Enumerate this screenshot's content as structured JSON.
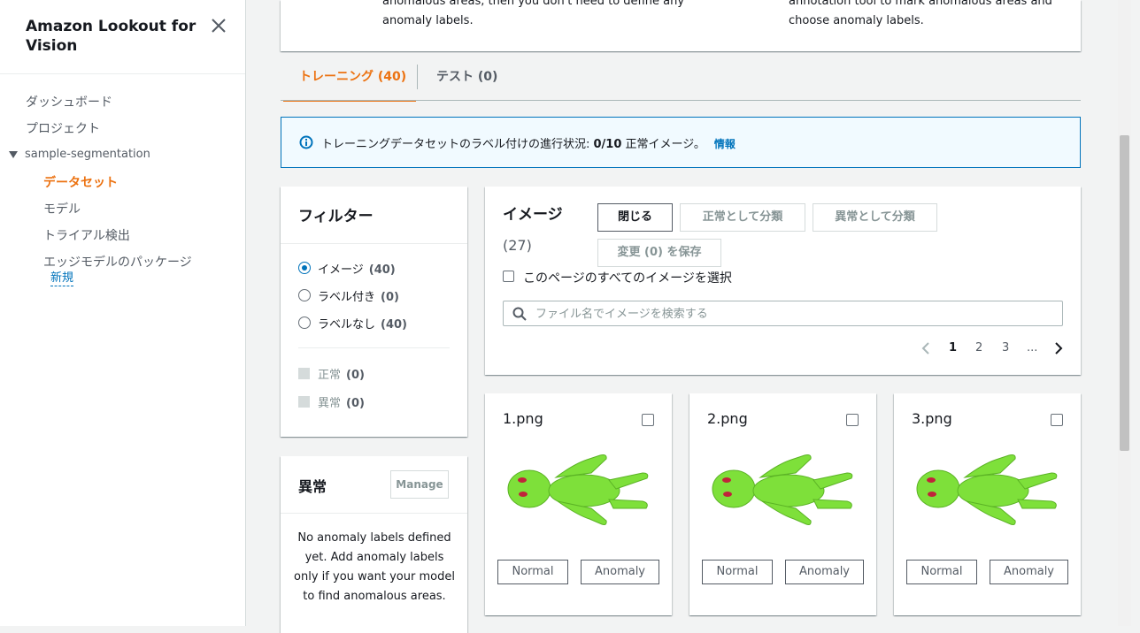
{
  "sidebar": {
    "title": "Amazon Lookout for Vision",
    "items": [
      {
        "label": "ダッシュボード"
      },
      {
        "label": "プロジェクト"
      },
      {
        "label": "sample-segmentation"
      },
      {
        "label": "データセット"
      },
      {
        "label": "モデル"
      },
      {
        "label": "トライアル検出"
      },
      {
        "label": "エッジモデルのパッケージ"
      }
    ],
    "new_badge": "新規"
  },
  "top_card": {
    "left_line1": "anomalous areas, then you don't need to define any",
    "left_line2": "anomaly labels.",
    "right_line1": "annotation tool to mark anomalous areas and",
    "right_line2": "choose anomaly labels."
  },
  "tabs": [
    {
      "label": "トレーニング (40)"
    },
    {
      "label": "テスト (0)"
    }
  ],
  "info": {
    "text_prefix": "トレーニングデータセットのラベル付けの進行状況: ",
    "progress": "0/10",
    "text_suffix": " 正常イメージ。",
    "link": "情報"
  },
  "filter": {
    "title": "フィルター",
    "options": [
      {
        "label": "イメージ",
        "count": "(40)"
      },
      {
        "label": "ラベル付き",
        "count": "(0)"
      },
      {
        "label": "ラベルなし",
        "count": "(40)"
      }
    ],
    "classes": [
      {
        "label": "正常",
        "count": "(0)"
      },
      {
        "label": "異常",
        "count": "(0)"
      }
    ]
  },
  "anomaly": {
    "title": "異常",
    "manage": "Manage",
    "text": "No anomaly labels defined yet. Add anomaly labels only if you want your model to find anomalous areas."
  },
  "images": {
    "title": "イメージ",
    "count": "(27)",
    "close_button": "閉じる",
    "normal_button": "正常として分類",
    "anomaly_button": "異常として分類",
    "save_button": "変更 (0) を保存",
    "select_all": "このページのすべてのイメージを選択",
    "search_placeholder": "ファイル名でイメージを検索する",
    "pages": [
      "1",
      "2",
      "3",
      "..."
    ]
  },
  "tiles": [
    {
      "name": "1.png",
      "normal": "Normal",
      "anomaly": "Anomaly"
    },
    {
      "name": "2.png",
      "normal": "Normal",
      "anomaly": "Anomaly"
    },
    {
      "name": "3.png",
      "normal": "Normal",
      "anomaly": "Anomaly"
    }
  ],
  "colors": {
    "accent": "#ec7211",
    "link": "#0073bb",
    "figure": "#7ee03a"
  }
}
